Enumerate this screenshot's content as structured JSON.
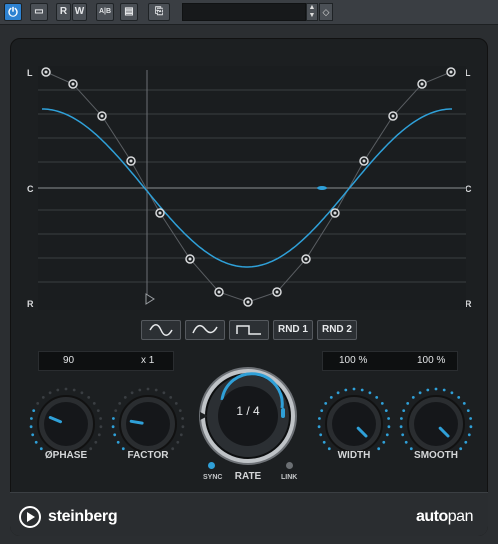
{
  "toolbar": {
    "power_icon": "power-icon",
    "read_label": "R",
    "write_label": "W",
    "ab_label": "A|B",
    "preset_name": ""
  },
  "graph": {
    "left_label": "L",
    "center_label": "C",
    "right_label": "R"
  },
  "waveforms": {
    "sine": "sine-wave-icon",
    "triangle": "triangle-wave-icon",
    "square": "square-wave-icon",
    "rnd1": "RND 1",
    "rnd2": "RND 2"
  },
  "displays": {
    "phase_value": "90",
    "factor_value": "x 1",
    "width_value": "100 %",
    "smooth_value": "100 %"
  },
  "knobs": {
    "phase_label": "PHASE",
    "phase_symbol": "Ø",
    "factor_label": "FACTOR",
    "rate_label": "RATE",
    "rate_value": "1 / 4",
    "sync_label": "SYNC",
    "link_label": "LINK",
    "width_label": "WIDTH",
    "smooth_label": "SMOOTH",
    "phase_level": 0.25,
    "factor_level": 0.2,
    "width_level": 1.0,
    "smooth_level": 1.0
  },
  "footer": {
    "brand": "steinberg",
    "product_a": "auto",
    "product_b": "pan"
  },
  "colors": {
    "accent": "#2fa0d8",
    "panel": "#1c1f21",
    "toolbar": "#3a3e43"
  }
}
